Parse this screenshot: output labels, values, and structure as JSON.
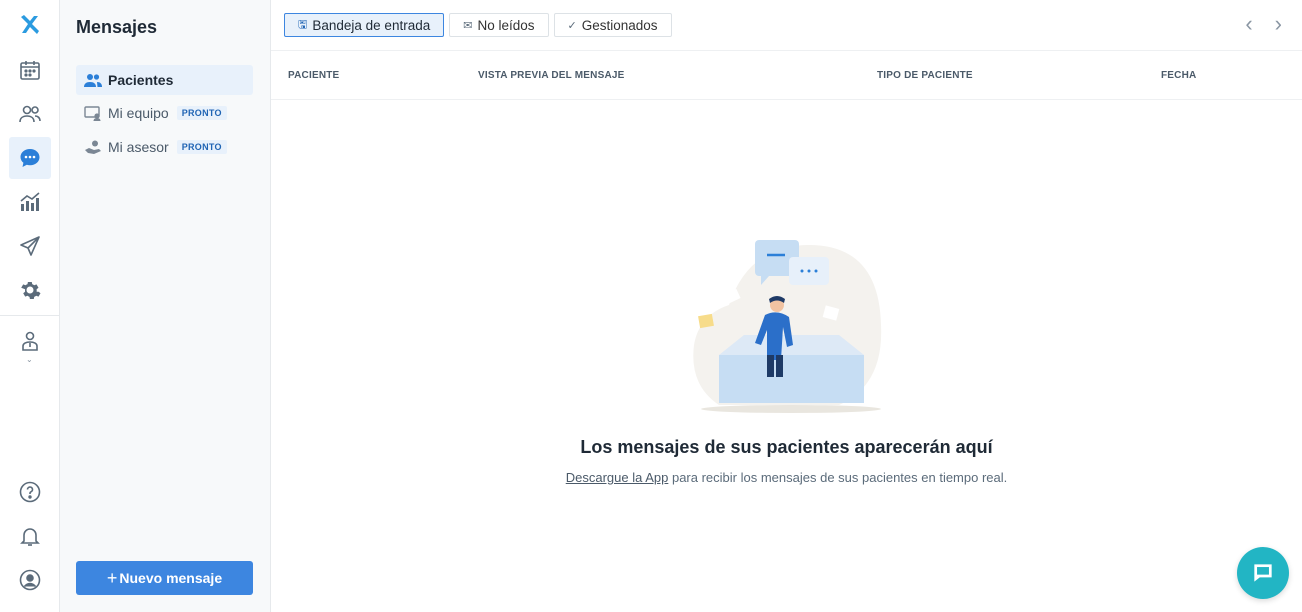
{
  "colors": {
    "accent": "#3d86e0",
    "active_bg": "#e8f1fb",
    "chat": "#22b5c4"
  },
  "rail": {
    "items": [
      {
        "icon": "brand-logo-icon"
      },
      {
        "icon": "calendar-icon"
      },
      {
        "icon": "patients-icon"
      },
      {
        "icon": "messages-icon"
      },
      {
        "icon": "stats-icon"
      },
      {
        "icon": "send-icon"
      },
      {
        "icon": "gear-icon"
      },
      {
        "icon": "advisor-icon"
      },
      {
        "icon": "help-icon"
      },
      {
        "icon": "bell-icon"
      },
      {
        "icon": "account-icon"
      }
    ]
  },
  "sidebar": {
    "title": "Mensajes",
    "items": [
      {
        "label": "Pacientes",
        "icon": "patients-icon"
      },
      {
        "label": "Mi equipo",
        "badge": "PRONTO",
        "icon": "team-icon"
      },
      {
        "label": "Mi asesor",
        "badge": "PRONTO",
        "icon": "handshake-icon"
      }
    ],
    "new_message": "Nuevo mensaje"
  },
  "tabs": [
    {
      "label": "Bandeja de entrada",
      "icon": "inbox-icon"
    },
    {
      "label": "No leídos",
      "icon": "envelope-icon"
    },
    {
      "label": "Gestionados",
      "icon": "check-icon"
    }
  ],
  "table": {
    "columns": [
      "PACIENTE",
      "VISTA PREVIA DEL MENSAJE",
      "TIPO DE PACIENTE",
      "FECHA"
    ]
  },
  "empty": {
    "title": "Los mensajes de sus pacientes aparecerán aquí",
    "link": "Descargue la App",
    "text": "para recibir los mensajes de sus pacientes en tiempo real."
  }
}
